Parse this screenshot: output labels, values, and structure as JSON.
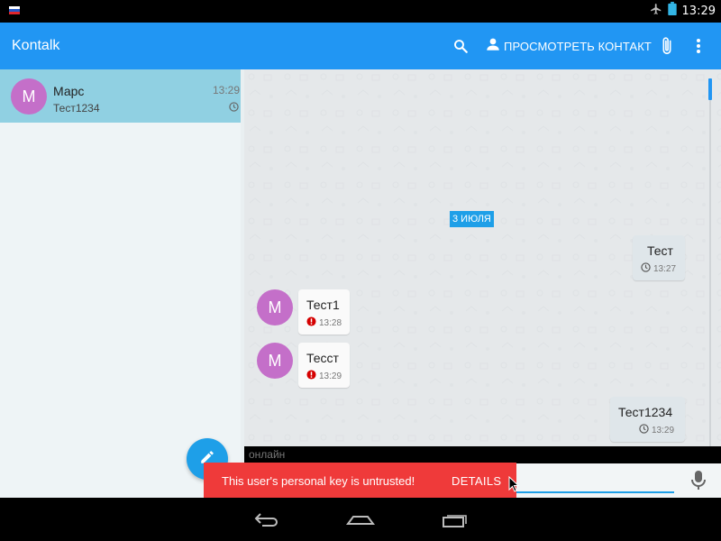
{
  "status_bar": {
    "time": "13:29",
    "icons": [
      "flag-russia-icon",
      "airplane-mode-icon",
      "battery-icon"
    ]
  },
  "toolbar": {
    "app_title": "Kontalk",
    "view_contact_label": "ПРОСМОТРЕТЬ КОНТАКТ",
    "icons": [
      "search-icon",
      "person-icon",
      "attach-icon",
      "more-vert-icon"
    ]
  },
  "conversations": [
    {
      "avatar_letter": "M",
      "name": "Марс",
      "last_message": "Тест1234",
      "time": "13:29",
      "status_icon": "clock-icon"
    }
  ],
  "chat": {
    "date_chip": "3 ИЮЛЯ",
    "messages": [
      {
        "direction": "out",
        "text": "Тест",
        "time": "13:27",
        "status_icon": "clock-icon"
      },
      {
        "direction": "in",
        "avatar_letter": "M",
        "text": "Тест1",
        "time": "13:28",
        "status_icon": "error-icon"
      },
      {
        "direction": "in",
        "avatar_letter": "M",
        "text": "Тесст",
        "time": "13:29",
        "status_icon": "error-icon"
      },
      {
        "direction": "out",
        "text": "Тест1234",
        "time": "13:29",
        "status_icon": "clock-icon"
      }
    ],
    "presence": "онлайн"
  },
  "snackbar": {
    "message": "This user's personal key is untrusted!",
    "action": "DETAILS"
  },
  "nav_bar": {
    "icons": [
      "back-icon",
      "home-icon",
      "recents-icon"
    ]
  },
  "colors": {
    "primary": "#2196f3",
    "accent": "#1e9fe8",
    "selected_row": "#90d0e2",
    "avatar": "#c46fc9",
    "snackbar": "#ef3a3a",
    "error": "#d50000"
  }
}
